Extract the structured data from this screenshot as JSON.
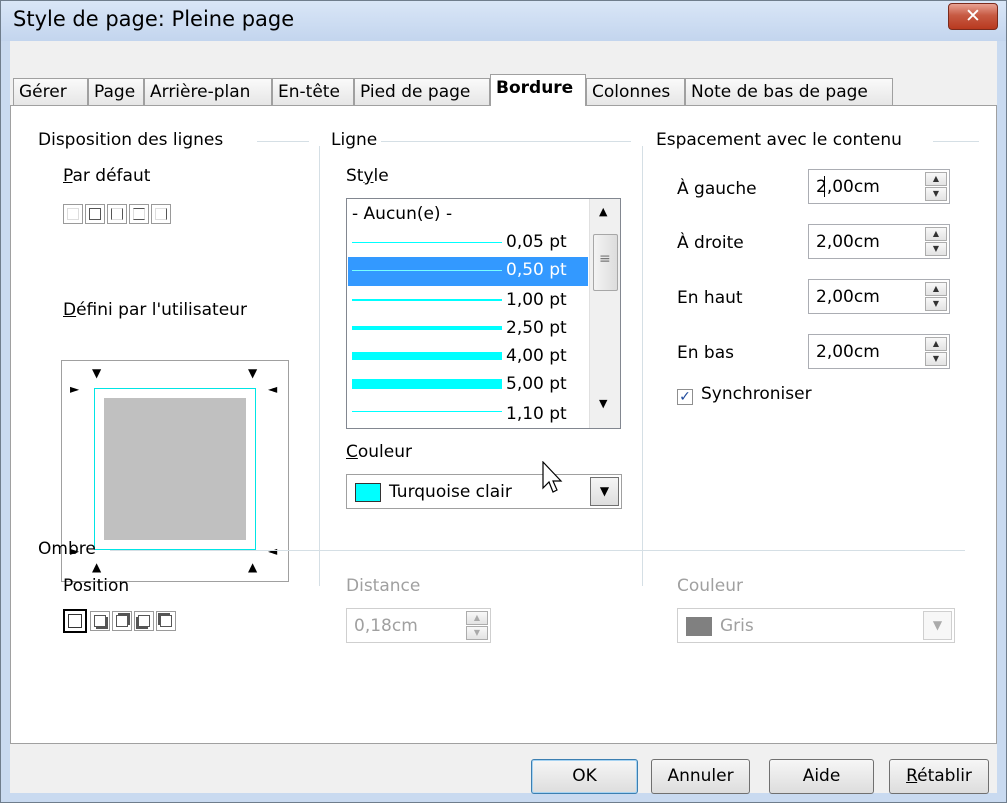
{
  "window": {
    "title": "Style de page: Pleine page",
    "close_label": "✕"
  },
  "tabs": [
    "Gérer",
    "Page",
    "Arrière-plan",
    "En-tête",
    "Pied de page",
    "Bordure",
    "Colonnes",
    "Note de bas de page"
  ],
  "active_tab": "Bordure",
  "line_arrangement": {
    "heading": "Disposition des lignes",
    "default_label": "Par défaut",
    "default_underline": "P",
    "default_rest": "ar défaut",
    "user_defined_label": "Défini par l'utilisateur",
    "user_defined_underline": "D",
    "user_defined_rest": "éfini par l'utilisateur"
  },
  "line": {
    "heading": "Ligne",
    "style_label": "Style",
    "style_pre": "St",
    "style_u": "y",
    "style_post": "le",
    "styles": [
      {
        "label": "- Aucun(e) -"
      },
      {
        "label": "0,05 pt"
      },
      {
        "label": "0,50 pt"
      },
      {
        "label": "1,00 pt"
      },
      {
        "label": "2,50 pt"
      },
      {
        "label": "4,00 pt"
      },
      {
        "label": "5,00 pt"
      },
      {
        "label": "1,10 pt"
      }
    ],
    "selected_style": "0,50 pt",
    "color_label": "Couleur",
    "color_underline": "C",
    "color_rest": "ouleur",
    "color_value": "Turquoise clair",
    "color_hex": "#00ffff"
  },
  "spacing": {
    "heading": "Espacement avec le contenu",
    "left_label": "À gauche",
    "left_value": "2,00cm",
    "right_label": "À droite",
    "right_value": "2,00cm",
    "top_label": "En haut",
    "top_value": "2,00cm",
    "bottom_label": "En bas",
    "bottom_value": "2,00cm",
    "sync_label": "Synchroniser",
    "sync_checked": true
  },
  "shadow": {
    "heading": "Ombre",
    "position_label": "Position",
    "distance_label": "Distance",
    "distance_value": "0,18cm",
    "color_label": "Couleur",
    "color_value": "Gris",
    "color_hex": "#808080"
  },
  "buttons": {
    "ok": "OK",
    "cancel": "Annuler",
    "help": "Aide",
    "reset": "Rétablir"
  }
}
